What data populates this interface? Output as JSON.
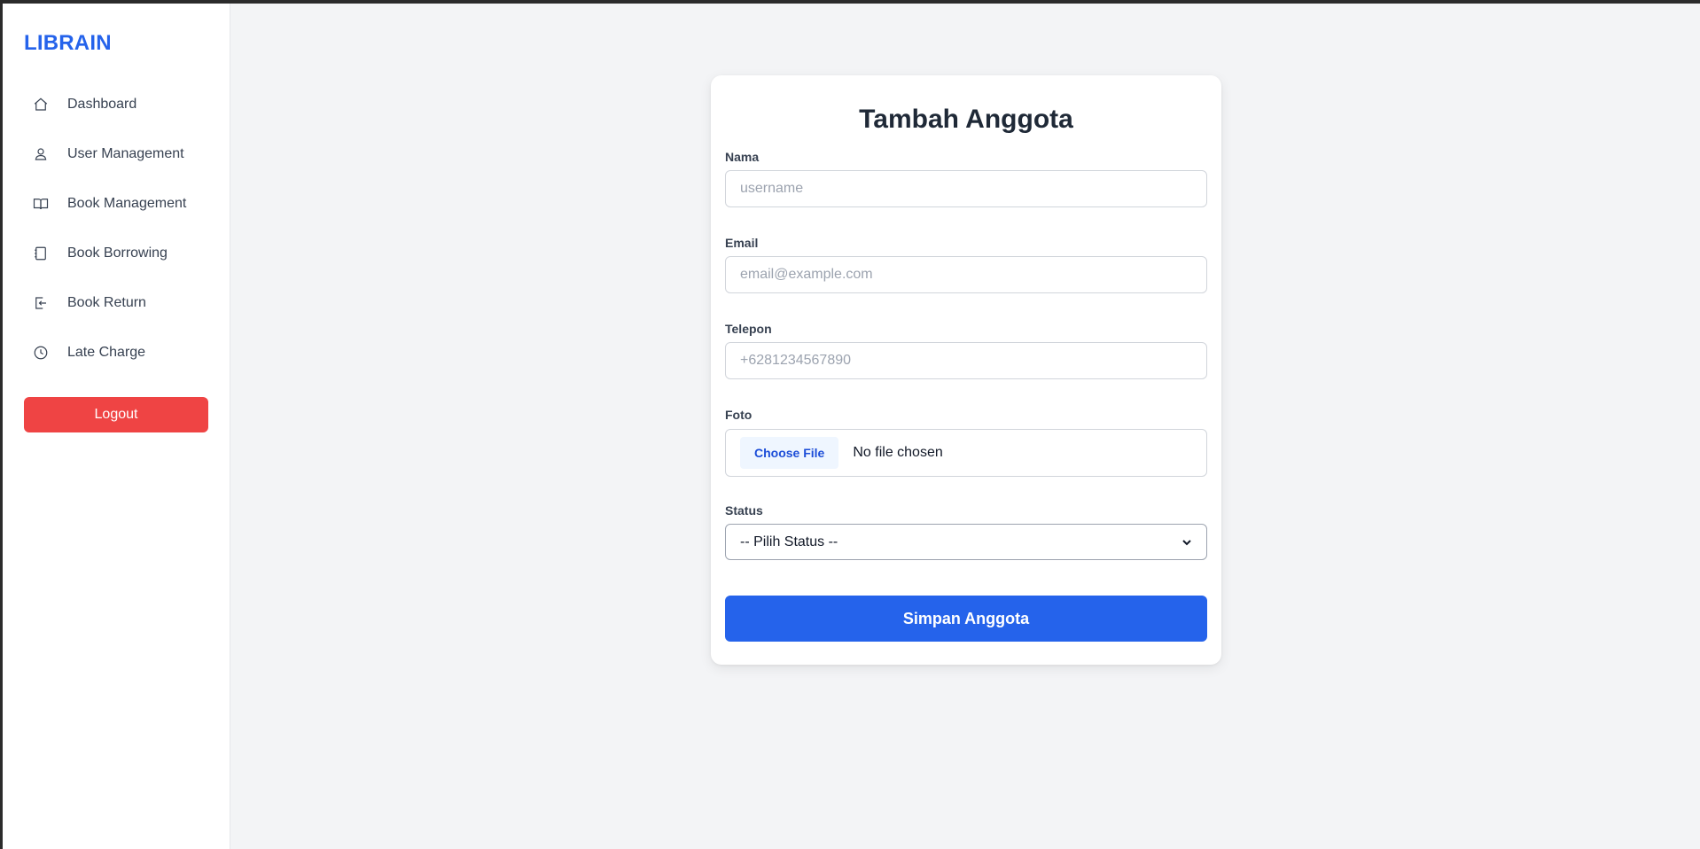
{
  "sidebar": {
    "brand": "LIBRAIN",
    "items": [
      {
        "label": "Dashboard",
        "icon": "home-icon"
      },
      {
        "label": "User Management",
        "icon": "user-icon"
      },
      {
        "label": "Book Management",
        "icon": "book-open-icon"
      },
      {
        "label": "Book Borrowing",
        "icon": "notebook-icon"
      },
      {
        "label": "Book Return",
        "icon": "return-icon"
      },
      {
        "label": "Late Charge",
        "icon": "clock-icon"
      }
    ],
    "logout_label": "Logout"
  },
  "form": {
    "title": "Tambah Anggota",
    "nama": {
      "label": "Nama",
      "placeholder": "username"
    },
    "email": {
      "label": "Email",
      "placeholder": "email@example.com"
    },
    "telepon": {
      "label": "Telepon",
      "placeholder": "+6281234567890"
    },
    "foto": {
      "label": "Foto",
      "button_label": "Choose File",
      "status": "No file chosen"
    },
    "status": {
      "label": "Status",
      "selected": "-- Pilih Status --"
    },
    "submit_label": "Simpan Anggota"
  },
  "colors": {
    "brand": "#2563eb",
    "logout": "#ef4444",
    "submit": "#2563eb",
    "background": "#f3f4f6"
  }
}
